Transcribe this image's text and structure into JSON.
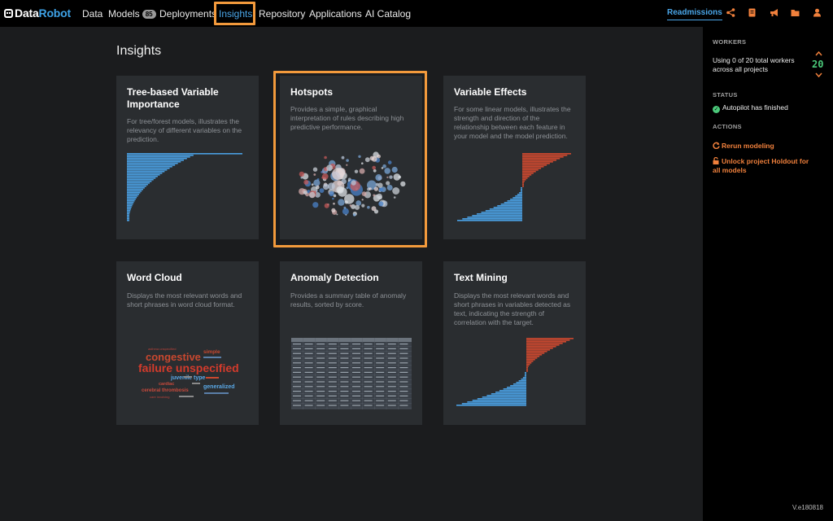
{
  "nav": {
    "logo_part1": "Data",
    "logo_part2": "Robot",
    "items": [
      {
        "label": "Data"
      },
      {
        "label": "Models",
        "badge": "85"
      },
      {
        "label": "Deployments"
      },
      {
        "label": "Insights"
      },
      {
        "label": "Repository"
      },
      {
        "label": "Applications"
      },
      {
        "label": "AI Catalog"
      }
    ],
    "project": "Readmissions",
    "icons": [
      "share-icon",
      "document-icon",
      "megaphone-icon",
      "folder-icon",
      "user-icon"
    ]
  },
  "page": {
    "title": "Insights"
  },
  "cards": [
    {
      "title": "Tree-based Variable Importance",
      "desc": "For tree/forest models, illustrates the relevancy of different variables on the prediction."
    },
    {
      "title": "Hotspots",
      "desc": "Provides a simple, graphical interpretation of rules describing high predictive performance."
    },
    {
      "title": "Variable Effects",
      "desc": "For some linear models, illustrates the strength and direction of the relationship between each feature in your model and the model prediction."
    },
    {
      "title": "Word Cloud",
      "desc": "Displays the most relevant words and short phrases in word cloud format."
    },
    {
      "title": "Anomaly Detection",
      "desc": "Provides a summary table of anomaly results, sorted by score."
    },
    {
      "title": "Text Mining",
      "desc": "Displays the most relevant words and short phrases in variables detected as text, indicating the strength of correlation with the target."
    }
  ],
  "wordcloud": {
    "words": [
      "asthma unspecified",
      "congestive",
      "failure unspecified",
      "simple",
      "juvenile type",
      "cardiac",
      "cerebral thrombosis",
      "generalized",
      "care involving"
    ]
  },
  "sidebar": {
    "workers_head": "WORKERS",
    "workers_text": "Using 0 of 20 total workers across all projects",
    "workers_count": "20",
    "status_head": "STATUS",
    "status_text": "Autopilot has finished",
    "actions_head": "ACTIONS",
    "action_rerun": "Rerun modeling",
    "action_unlock": "Unlock project Holdout for all models"
  },
  "version": "V.e180818",
  "colors": {
    "accent": "#f39a3c",
    "link": "#4aa6e8",
    "positive": "#4bc97a",
    "bar_blue": "#4a9ee0",
    "bar_red": "#c9482f"
  }
}
